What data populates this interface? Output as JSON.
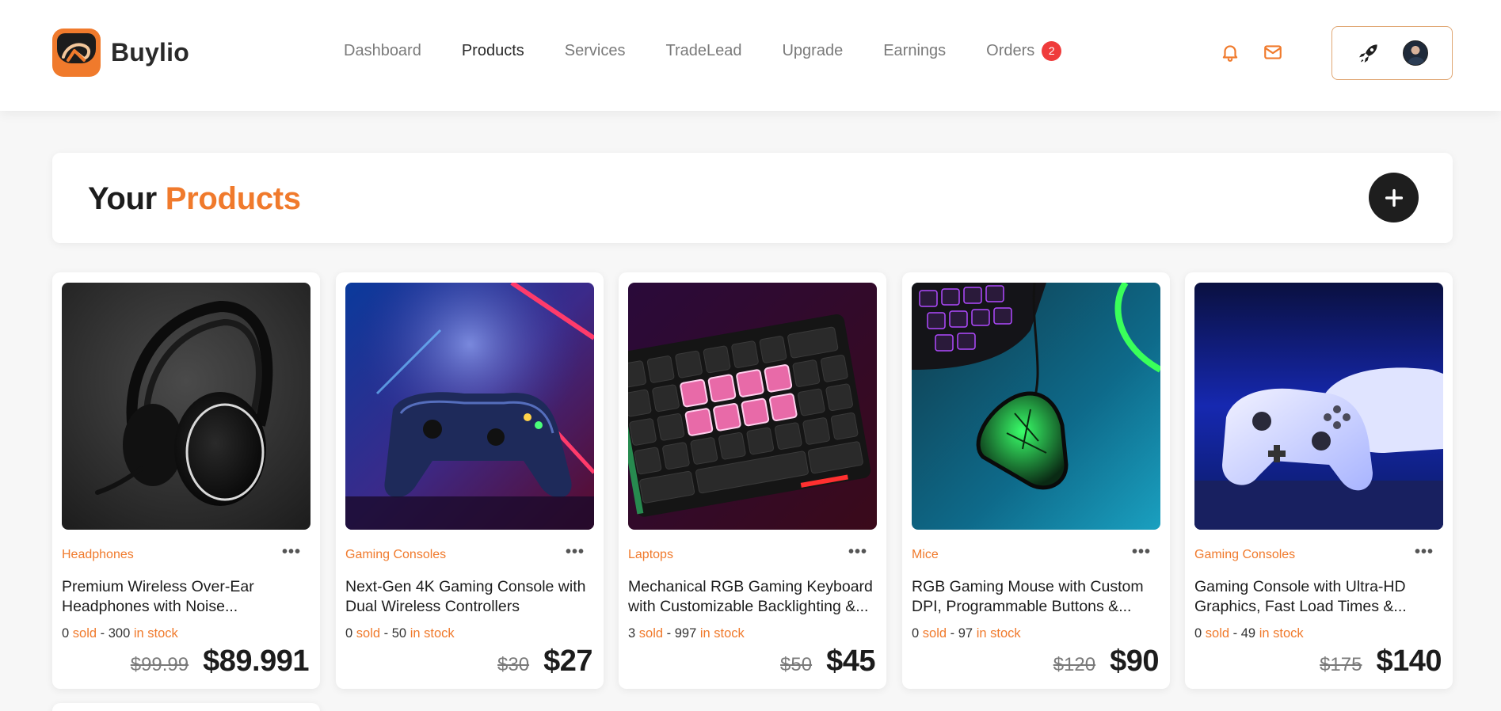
{
  "app": {
    "name": "Buylio"
  },
  "nav": {
    "items": [
      {
        "label": "Dashboard",
        "active": false
      },
      {
        "label": "Products",
        "active": true
      },
      {
        "label": "Services",
        "active": false
      },
      {
        "label": "TradeLead",
        "active": false
      },
      {
        "label": "Upgrade",
        "active": false
      },
      {
        "label": "Earnings",
        "active": false
      },
      {
        "label": "Orders",
        "active": false,
        "badge": "2"
      }
    ]
  },
  "header_icons": [
    "bell-icon",
    "mail-icon",
    "rocket-icon",
    "avatar"
  ],
  "page": {
    "title_prefix": "Your",
    "title_accent": "Products",
    "add_icon": "plus-icon"
  },
  "colors": {
    "accent": "#f07a2c",
    "badge": "#ef3b3b",
    "dark": "#1e1e1e"
  },
  "products": [
    {
      "category": "Headphones",
      "name": "Premium Wireless Over-Ear Headphones with Noise...",
      "sold": "0",
      "sold_label": "sold",
      "sep": "- 300",
      "stock_label": "in stock",
      "old_price": "$99.99",
      "price": "$89.991",
      "image": "headphones"
    },
    {
      "category": "Gaming Consoles",
      "name": "Next-Gen 4K Gaming Console with Dual Wireless Controllers",
      "sold": "0",
      "sold_label": "sold",
      "sep": "- 50",
      "stock_label": "in stock",
      "old_price": "$30",
      "price": "$27",
      "image": "controller-neon"
    },
    {
      "category": "Laptops",
      "name": "Mechanical RGB Gaming Keyboard with Customizable Backlighting &...",
      "sold": "3",
      "sold_label": "sold",
      "sep": "- 997",
      "stock_label": "in stock",
      "old_price": "$50",
      "price": "$45",
      "image": "keyboard"
    },
    {
      "category": "Mice",
      "name": "RGB Gaming Mouse with Custom DPI, Programmable Buttons &...",
      "sold": "0",
      "sold_label": "sold",
      "sep": "- 97",
      "stock_label": "in stock",
      "old_price": "$120",
      "price": "$90",
      "image": "mouse"
    },
    {
      "category": "Gaming Consoles",
      "name": "Gaming Console with Ultra-HD Graphics, Fast Load Times &...",
      "sold": "0",
      "sold_label": "sold",
      "sep": "- 49",
      "stock_label": "in stock",
      "old_price": "$175",
      "price": "$140",
      "image": "controller-white"
    }
  ]
}
